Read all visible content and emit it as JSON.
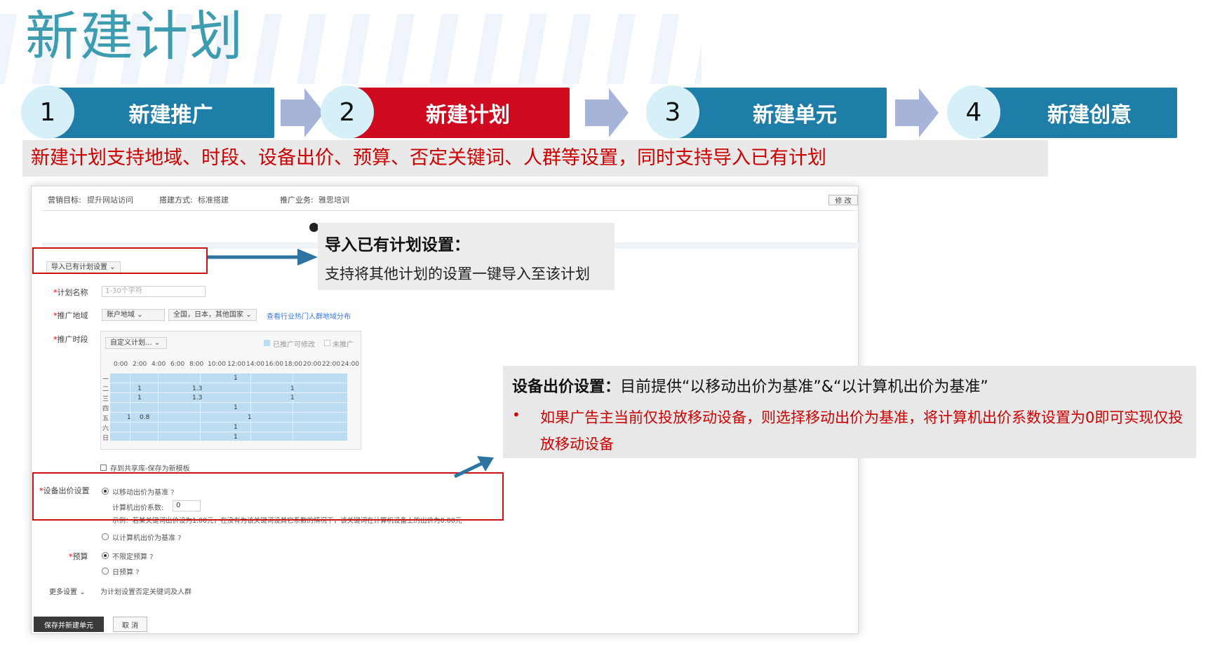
{
  "page": {
    "title": "新建计划"
  },
  "steps": [
    {
      "number": "1",
      "label": "新建推广"
    },
    {
      "number": "2",
      "label": "新建计划"
    },
    {
      "number": "3",
      "label": "新建单元"
    },
    {
      "number": "4",
      "label": "新建创意"
    }
  ],
  "subtitle": "新建计划支持地域、时段、设备出价、预算、否定关键词、人群等设置，同时支持导入已有计划",
  "colors": {
    "title": "#3d9cb0",
    "step_blue": "#1f7ea7",
    "step_active": "#cf0a1e",
    "highlight_red": "#cc0000"
  },
  "form": {
    "header": {
      "goal_label": "营销目标:",
      "goal_value": "提升网站访问",
      "method_label": "搭建方式:",
      "method_value": "标准搭建",
      "business_label": "推广业务:",
      "business_value": "雅思培训",
      "edit_button": "修 改"
    },
    "import_select": "导入已有计划设置",
    "plan_name": {
      "label": "计划名称",
      "placeholder": "1-30个字符"
    },
    "region": {
      "label": "推广地域",
      "select": "账户地域",
      "value": "全国，日本，其他国家",
      "link": "查看行业热门人群地域分布"
    },
    "schedule": {
      "label": "推广时段",
      "select": "自定义计划...",
      "legend_modified": "已推广可修改",
      "legend_none": "未推广",
      "hours": [
        "0:00",
        "2:00",
        "4:00",
        "6:00",
        "8:00",
        "10:00",
        "12:00",
        "14:00",
        "16:00",
        "18:00",
        "20:00",
        "22:00",
        "24:00"
      ],
      "days": [
        "一",
        "二",
        "三",
        "四",
        "五",
        "六",
        "日"
      ],
      "values": [
        {
          "text": "1"
        },
        {
          "text": "1"
        },
        {
          "text": "1.3"
        },
        {
          "text": "1"
        },
        {
          "text": "1"
        },
        {
          "text": "1.3"
        },
        {
          "text": "1"
        },
        {
          "text": "1"
        },
        {
          "text": "1"
        },
        {
          "text": "0.8"
        },
        {
          "text": "1"
        },
        {
          "text": "1"
        },
        {
          "text": "1"
        }
      ],
      "save_template": "存到共享库-保存为新模板"
    },
    "device_bid": {
      "label": "设备出价设置",
      "option_mobile": "以移动出价为基准",
      "coef_label": "计算机出价系数:",
      "coef_value": "0",
      "example": "示例：若某关键词出价设为1.00元，在没有为该关键词设其它系数的情况下，该关键词在计算机设备上的出价为0.00元",
      "option_pc": "以计算机出价为基准"
    },
    "budget": {
      "label": "预算",
      "option_unlimited": "不限定预算",
      "option_daily": "日预算"
    },
    "more": {
      "label": "更多设置",
      "desc": "为计划设置否定关键词及人群"
    },
    "buttons": {
      "save": "保存并新建单元",
      "cancel": "取 消"
    }
  },
  "callouts": {
    "import": {
      "title": "导入已有计划设置：",
      "body": "支持将其他计划的设置一键导入至该计划"
    },
    "device": {
      "title": "设备出价设置：",
      "text": "目前提供“以移动出价为基准”&“以计算机出价为基准”",
      "bullet": "•",
      "body": "如果广告主当前仅投放移动设备，则选择移动出价为基准，将计算机出价系数设置为0即可实现仅投放移动设备"
    }
  },
  "icons": {
    "help": "?",
    "chevron": "⌄"
  }
}
